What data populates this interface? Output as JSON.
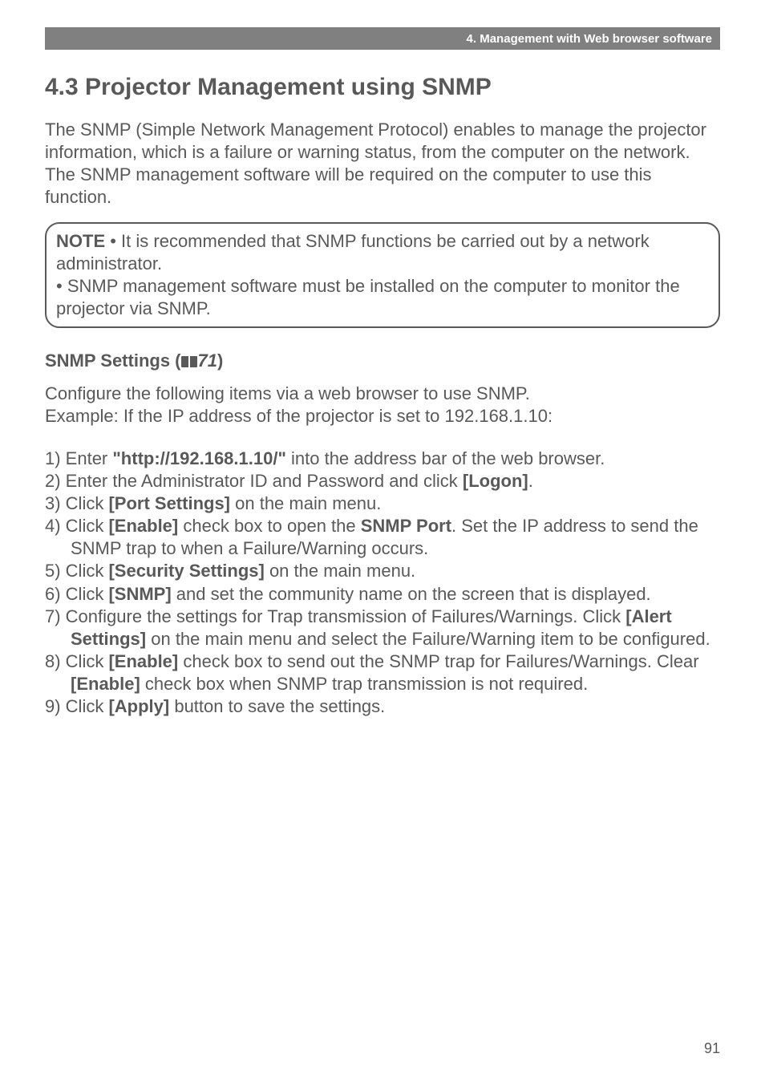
{
  "header": {
    "chapter": "4. Management with Web browser software"
  },
  "section": {
    "title": "4.3 Projector Management using SNMP",
    "intro": "The SNMP (Simple Network Management Protocol) enables to manage the projector information, which is a failure or warning status, from the computer on the network. The SNMP management software will be required on the computer to use this function."
  },
  "note": {
    "label": "NOTE",
    "para1": " • It is recommended that SNMP functions be carried out by a network administrator.",
    "para2": "• SNMP management software must be installed on the computer to monitor the projector via SNMP."
  },
  "snmp": {
    "title_prefix": "SNMP Settings (",
    "ref_num": "71",
    "title_suffix": ")",
    "config_line1": "Configure the following items via a web browser to use SNMP.",
    "config_line2": "Example: If the IP address of the projector is set to 192.168.1.10:"
  },
  "steps": {
    "s1_a": "1) Enter ",
    "s1_b": "\"http://192.168.1.10/\"",
    "s1_c": " into the address bar of the web browser.",
    "s2_a": "2) Enter the Administrator ID and Password and click ",
    "s2_b": "[Logon]",
    "s2_c": ".",
    "s3_a": "3) Click ",
    "s3_b": "[Port Settings]",
    "s3_c": " on the main menu.",
    "s4_a": "4) Click ",
    "s4_b": "[Enable]",
    "s4_c": " check box to open the ",
    "s4_d": "SNMP Port",
    "s4_e": ". Set the IP address to send the SNMP trap to when a Failure/Warning occurs.",
    "s5_a": "5) Click ",
    "s5_b": "[Security Settings]",
    "s5_c": " on the main menu.",
    "s6_a": "6) Click ",
    "s6_b": "[SNMP]",
    "s6_c": " and set the community name on the screen that is displayed.",
    "s7_a": "7) Configure the settings for Trap transmission of Failures/Warnings. Click ",
    "s7_b": "[Alert Settings]",
    "s7_c": " on the main menu and select the Failure/Warning item to be configured.",
    "s8_a": "8) Click ",
    "s8_b": "[Enable]",
    "s8_c": " check box to send out the SNMP trap for Failures/Warnings. Clear ",
    "s8_d": "[Enable]",
    "s8_e": " check box when SNMP trap transmission is not required.",
    "s9_a": "9) Click ",
    "s9_b": "[Apply]",
    "s9_c": " button to save the settings."
  },
  "page_number": "91"
}
